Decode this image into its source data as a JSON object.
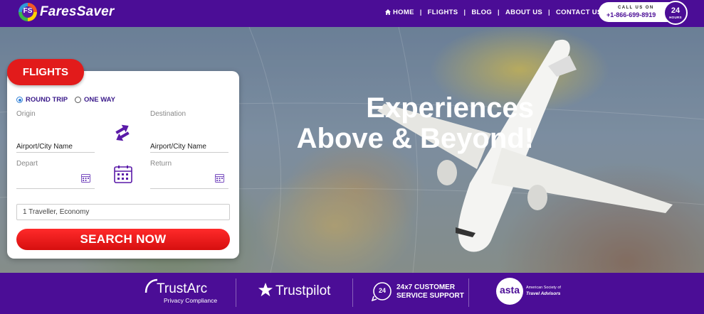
{
  "brand": {
    "name": "FaresSaver",
    "badge": "FS"
  },
  "nav": {
    "items": [
      "HOME",
      "FLIGHTS",
      "BLOG",
      "ABOUT US",
      "CONTACT US"
    ],
    "separator": "|"
  },
  "call": {
    "label": "CALL US ON",
    "number": "+1-866-699-8919",
    "hours_number": "24",
    "hours_label": "HOURS"
  },
  "hero": {
    "line1": "Experiences",
    "line2": "Above & Beyond!"
  },
  "search": {
    "tab": "FLIGHTS",
    "trip_types": [
      "ROUND TRIP",
      "ONE WAY"
    ],
    "selected_trip": "ROUND TRIP",
    "origin_label": "Origin",
    "origin_placeholder": "Airport/City Name",
    "destination_label": "Destination",
    "destination_placeholder": "Airport/City Name",
    "depart_label": "Depart",
    "return_label": "Return",
    "travellers": "1 Traveller, Economy",
    "button": "SEARCH NOW"
  },
  "trust": {
    "trustarc": {
      "name": "TrustArc",
      "sub": "Privacy Compliance"
    },
    "trustpilot": {
      "name": "Trustpilot"
    },
    "support": {
      "badge": "24",
      "line1": "24x7 CUSTOMER",
      "line2": "SERVICE SUPPORT"
    },
    "asta": {
      "name": "asta",
      "line1": "American Society of",
      "line2": "Travel Advisors"
    }
  },
  "colors": {
    "brand_purple": "#4b0d96",
    "accent_red": "#e21b1b",
    "radio_blue": "#2e7fd6"
  }
}
